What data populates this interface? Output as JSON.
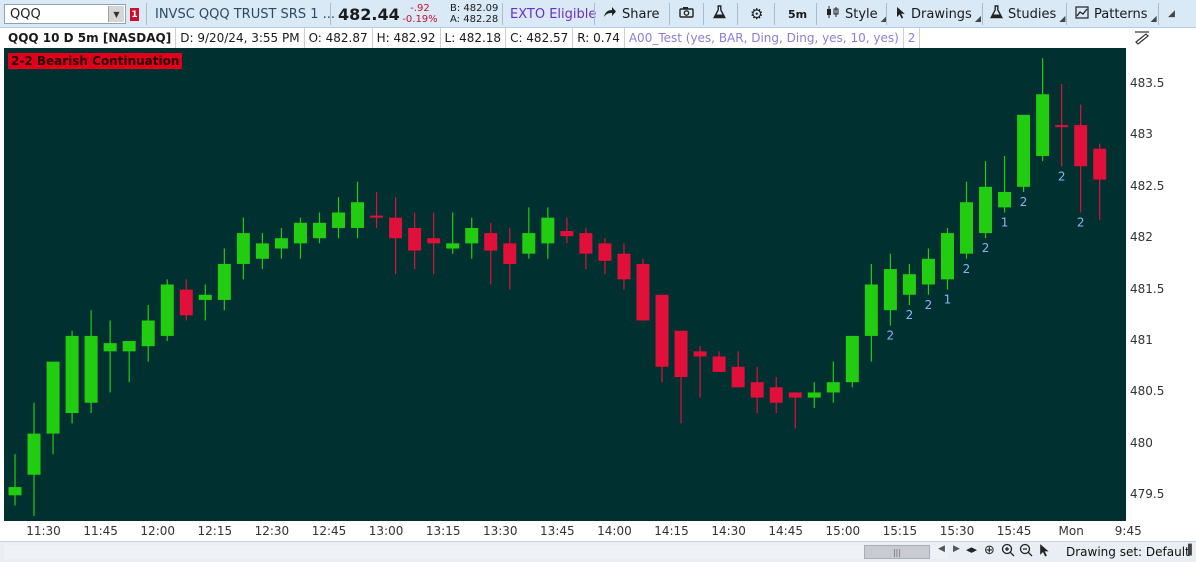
{
  "toolbar": {
    "symbol": "QQQ",
    "alert_badge": "1",
    "description": "INVSC QQQ TRUST SRS 1 ...",
    "last_price": "482.44",
    "net_change": "-.92",
    "pct_change": "-0.19%",
    "bid": "B: 482.09",
    "ask": "A: 482.28",
    "exto_label": "EXTO Eligible",
    "share_label": "Share",
    "timeframe_label": "5m",
    "style_label": "Style",
    "drawings_label": "Drawings",
    "studies_label": "Studies",
    "patterns_label": "Patterns"
  },
  "info_row": {
    "title": "QQQ 10 D 5m [NASDAQ]",
    "date": "D: 9/20/24, 3:55 PM",
    "open": "O: 482.87",
    "high": "H: 482.92",
    "low": "L: 482.18",
    "close": "C: 482.57",
    "range": "R: 0.74",
    "study": "A00_Test (yes, BAR, Ding, Ding, yes, 10, yes)",
    "study_value": "2"
  },
  "signal_label": "2-2 Bearish Continuation",
  "chart_data": {
    "type": "candlestick",
    "y_ticks": [
      "483.5",
      "483",
      "482.5",
      "482",
      "481.5",
      "481",
      "480.5",
      "480",
      "479.5"
    ],
    "y_tick_values": [
      483.5,
      483,
      482.5,
      482,
      481.5,
      481,
      480.5,
      480,
      479.5
    ],
    "ylim": [
      479.25,
      483.85
    ],
    "x_ticks": [
      "11:30",
      "11:45",
      "12:00",
      "12:15",
      "12:30",
      "12:45",
      "13:00",
      "13:15",
      "13:30",
      "13:45",
      "14:00",
      "14:15",
      "14:30",
      "14:45",
      "15:00",
      "15:15",
      "15:30",
      "15:45",
      "Mon",
      "9:45"
    ],
    "x_tick_bar_index": [
      1.5,
      4.5,
      7.5,
      10.5,
      13.5,
      16.5,
      19.5,
      22.5,
      25.5,
      28.5,
      31.5,
      34.5,
      37.5,
      40.5,
      43.5,
      46.5,
      49.5,
      52.5,
      55.5,
      58.5
    ],
    "colors": {
      "up": "#22cc11",
      "down": "#e0103a",
      "background": "#003030",
      "marker": "#8ab4f8"
    },
    "candles": [
      {
        "o": 479.5,
        "h": 479.9,
        "l": 479.4,
        "c": 479.58
      },
      {
        "o": 479.7,
        "h": 480.4,
        "l": 479.3,
        "c": 480.1
      },
      {
        "o": 480.1,
        "h": 480.6,
        "l": 479.9,
        "c": 480.8
      },
      {
        "o": 480.3,
        "h": 481.1,
        "l": 480.2,
        "c": 481.05
      },
      {
        "o": 480.4,
        "h": 481.3,
        "l": 480.3,
        "c": 481.05
      },
      {
        "o": 480.9,
        "h": 481.2,
        "l": 480.5,
        "c": 480.98
      },
      {
        "o": 480.9,
        "h": 481.0,
        "l": 480.6,
        "c": 481.0
      },
      {
        "o": 480.95,
        "h": 481.35,
        "l": 480.8,
        "c": 481.2
      },
      {
        "o": 481.05,
        "h": 481.6,
        "l": 481.0,
        "c": 481.55
      },
      {
        "o": 481.5,
        "h": 481.6,
        "l": 481.2,
        "c": 481.25
      },
      {
        "o": 481.4,
        "h": 481.55,
        "l": 481.2,
        "c": 481.45
      },
      {
        "o": 481.4,
        "h": 481.9,
        "l": 481.3,
        "c": 481.75
      },
      {
        "o": 481.75,
        "h": 482.2,
        "l": 481.6,
        "c": 482.05
      },
      {
        "o": 481.8,
        "h": 482.05,
        "l": 481.7,
        "c": 481.95
      },
      {
        "o": 481.9,
        "h": 482.1,
        "l": 481.8,
        "c": 482.0
      },
      {
        "o": 481.95,
        "h": 482.2,
        "l": 481.8,
        "c": 482.15
      },
      {
        "o": 482.0,
        "h": 482.25,
        "l": 481.95,
        "c": 482.15
      },
      {
        "o": 482.1,
        "h": 482.4,
        "l": 482.0,
        "c": 482.25
      },
      {
        "o": 482.1,
        "h": 482.55,
        "l": 482.0,
        "c": 482.35
      },
      {
        "o": 482.22,
        "h": 482.45,
        "l": 482.1,
        "c": 482.2
      },
      {
        "o": 482.2,
        "h": 482.4,
        "l": 481.65,
        "c": 482.0
      },
      {
        "o": 482.1,
        "h": 482.25,
        "l": 481.7,
        "c": 481.88
      },
      {
        "o": 482.0,
        "h": 482.25,
        "l": 481.65,
        "c": 481.95
      },
      {
        "o": 481.9,
        "h": 482.25,
        "l": 481.85,
        "c": 481.95
      },
      {
        "o": 481.95,
        "h": 482.2,
        "l": 481.8,
        "c": 482.1
      },
      {
        "o": 482.05,
        "h": 482.15,
        "l": 481.55,
        "c": 481.88
      },
      {
        "o": 481.95,
        "h": 482.1,
        "l": 481.5,
        "c": 481.75
      },
      {
        "o": 481.85,
        "h": 482.3,
        "l": 481.8,
        "c": 482.05
      },
      {
        "o": 481.95,
        "h": 482.3,
        "l": 481.8,
        "c": 482.2
      },
      {
        "o": 482.07,
        "h": 482.2,
        "l": 481.95,
        "c": 482.02
      },
      {
        "o": 482.05,
        "h": 482.1,
        "l": 481.7,
        "c": 481.85
      },
      {
        "o": 481.95,
        "h": 482.0,
        "l": 481.65,
        "c": 481.78
      },
      {
        "o": 481.85,
        "h": 481.95,
        "l": 481.5,
        "c": 481.6
      },
      {
        "o": 481.75,
        "h": 481.8,
        "l": 481.25,
        "c": 481.2
      },
      {
        "o": 481.45,
        "h": 481.45,
        "l": 480.6,
        "c": 480.75
      },
      {
        "o": 481.1,
        "h": 481.1,
        "l": 480.2,
        "c": 480.65
      },
      {
        "o": 480.9,
        "h": 480.95,
        "l": 480.45,
        "c": 480.85
      },
      {
        "o": 480.85,
        "h": 480.9,
        "l": 480.7,
        "c": 480.7
      },
      {
        "o": 480.75,
        "h": 480.9,
        "l": 480.55,
        "c": 480.55
      },
      {
        "o": 480.6,
        "h": 480.75,
        "l": 480.3,
        "c": 480.45
      },
      {
        "o": 480.55,
        "h": 480.65,
        "l": 480.3,
        "c": 480.4
      },
      {
        "o": 480.5,
        "h": 480.5,
        "l": 480.15,
        "c": 480.45
      },
      {
        "o": 480.45,
        "h": 480.6,
        "l": 480.35,
        "c": 480.5
      },
      {
        "o": 480.5,
        "h": 480.8,
        "l": 480.4,
        "c": 480.6
      },
      {
        "o": 480.6,
        "h": 481.05,
        "l": 480.55,
        "c": 481.05
      },
      {
        "o": 481.05,
        "h": 481.75,
        "l": 480.8,
        "c": 481.55
      },
      {
        "o": 481.3,
        "h": 481.85,
        "l": 481.15,
        "c": 481.7
      },
      {
        "o": 481.45,
        "h": 481.75,
        "l": 481.35,
        "c": 481.65
      },
      {
        "o": 481.55,
        "h": 481.9,
        "l": 481.45,
        "c": 481.8
      },
      {
        "o": 481.6,
        "h": 482.1,
        "l": 481.5,
        "c": 482.05
      },
      {
        "o": 481.85,
        "h": 482.55,
        "l": 481.8,
        "c": 482.35
      },
      {
        "o": 482.05,
        "h": 482.75,
        "l": 482.0,
        "c": 482.5
      },
      {
        "o": 482.3,
        "h": 482.8,
        "l": 482.25,
        "c": 482.45
      },
      {
        "o": 482.5,
        "h": 483.0,
        "l": 482.45,
        "c": 483.2
      },
      {
        "o": 482.8,
        "h": 483.75,
        "l": 482.75,
        "c": 483.4
      },
      {
        "o": 483.1,
        "h": 483.5,
        "l": 482.7,
        "c": 483.08
      },
      {
        "o": 483.1,
        "h": 483.3,
        "l": 482.25,
        "c": 482.7
      },
      {
        "o": 482.87,
        "h": 482.92,
        "l": 482.18,
        "c": 482.57
      }
    ],
    "markers": [
      {
        "i": 46,
        "label": "2"
      },
      {
        "i": 47,
        "label": "2"
      },
      {
        "i": 48,
        "label": "2"
      },
      {
        "i": 49,
        "label": "1"
      },
      {
        "i": 50,
        "label": "2"
      },
      {
        "i": 51,
        "label": "2"
      },
      {
        "i": 52,
        "label": "1"
      },
      {
        "i": 53,
        "label": "2"
      },
      {
        "i": 55,
        "label": "2"
      },
      {
        "i": 56,
        "label": "2"
      }
    ]
  },
  "bottom": {
    "drawing_set": "Drawing set: Default"
  }
}
